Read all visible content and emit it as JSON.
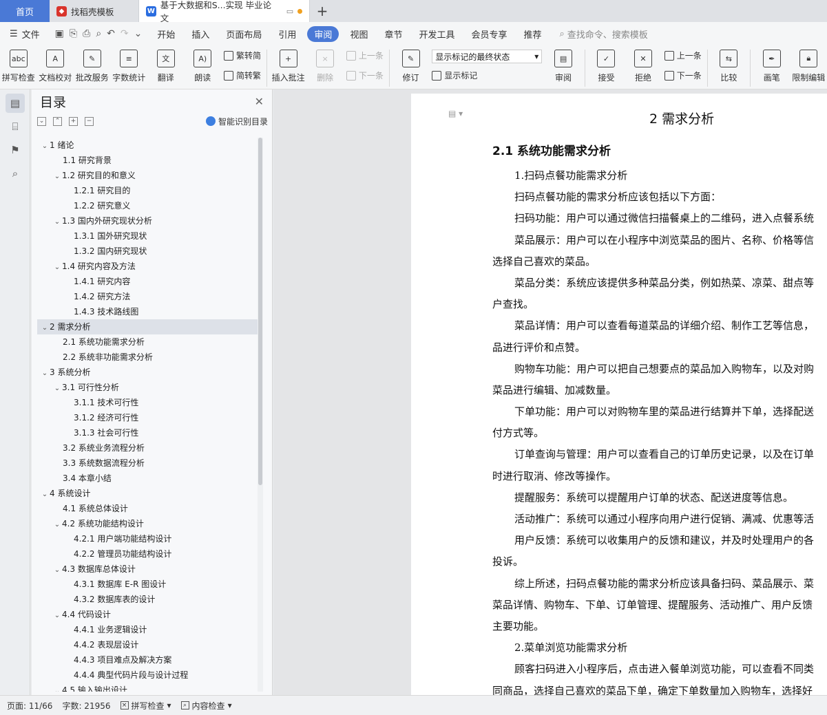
{
  "tabs": {
    "home": "首页",
    "templates": "找稻壳模板",
    "document": "基于大数据和S...实现 毕业论文"
  },
  "menu": {
    "file": "文件",
    "items": [
      "开始",
      "插入",
      "页面布局",
      "引用",
      "审阅",
      "视图",
      "章节",
      "开发工具",
      "会员专享",
      "推荐"
    ],
    "active": "审阅",
    "search_placeholder": "查找命令、搜索模板"
  },
  "ribbon": {
    "spellcheck": "拼写检查",
    "doc_proof": "文档校对",
    "review_service": "批改服务",
    "word_count": "字数统计",
    "translate": "翻译",
    "read_aloud": "朗读",
    "trad_to_simp_1": "繁转简",
    "simp_to_trad": "简转繁",
    "insert_comment": "插入批注",
    "delete": "删除",
    "prev_1": "上一条",
    "next_1": "下一条",
    "track_changes": "修订",
    "markup_select": "显示标记的最终状态",
    "show_markup": "显示标记",
    "review": "审阅",
    "accept": "接受",
    "reject": "拒绝",
    "prev_2": "上一条",
    "next_2": "下一条",
    "compare": "比较",
    "pen": "画笔",
    "restrict_edit": "限制编辑"
  },
  "toc": {
    "title": "目录",
    "smart": "智能识别目录",
    "items": [
      {
        "label": "1  绪论",
        "level": 1,
        "arrow": true
      },
      {
        "label": "1.1 研究背景",
        "level": 2,
        "arrow": false
      },
      {
        "label": "1.2 研究目的和意义",
        "level": 2,
        "arrow": true
      },
      {
        "label": "1.2.1 研究目的",
        "level": 3,
        "arrow": false
      },
      {
        "label": "1.2.2 研究意义",
        "level": 3,
        "arrow": false
      },
      {
        "label": "1.3 国内外研究现状分析",
        "level": 2,
        "arrow": true
      },
      {
        "label": "1.3.1 国外研究现状",
        "level": 3,
        "arrow": false
      },
      {
        "label": "1.3.2 国内研究现状",
        "level": 3,
        "arrow": false
      },
      {
        "label": "1.4 研究内容及方法",
        "level": 2,
        "arrow": true
      },
      {
        "label": "1.4.1 研究内容",
        "level": 3,
        "arrow": false
      },
      {
        "label": "1.4.2 研究方法",
        "level": 3,
        "arrow": false
      },
      {
        "label": "1.4.3 技术路线图",
        "level": 3,
        "arrow": false
      },
      {
        "label": "2  需求分析",
        "level": 1,
        "arrow": true,
        "selected": true
      },
      {
        "label": "2.1 系统功能需求分析",
        "level": 2,
        "arrow": false
      },
      {
        "label": "2.2 系统非功能需求分析",
        "level": 2,
        "arrow": false
      },
      {
        "label": "3  系统分析",
        "level": 1,
        "arrow": true
      },
      {
        "label": "3.1 可行性分析",
        "level": 2,
        "arrow": true
      },
      {
        "label": "3.1.1 技术可行性",
        "level": 3,
        "arrow": false
      },
      {
        "label": "3.1.2 经济可行性",
        "level": 3,
        "arrow": false
      },
      {
        "label": "3.1.3 社会可行性",
        "level": 3,
        "arrow": false
      },
      {
        "label": "3.2 系统业务流程分析",
        "level": 2,
        "arrow": false
      },
      {
        "label": "3.3 系统数据流程分析",
        "level": 2,
        "arrow": false
      },
      {
        "label": "3.4 本章小结",
        "level": 2,
        "arrow": false
      },
      {
        "label": "4  系统设计",
        "level": 1,
        "arrow": true
      },
      {
        "label": "4.1 系统总体设计",
        "level": 2,
        "arrow": false
      },
      {
        "label": "4.2 系统功能结构设计",
        "level": 2,
        "arrow": true
      },
      {
        "label": "4.2.1 用户端功能结构设计",
        "level": 3,
        "arrow": false
      },
      {
        "label": "4.2.2 管理员功能结构设计",
        "level": 3,
        "arrow": false
      },
      {
        "label": "4.3 数据库总体设计",
        "level": 2,
        "arrow": true
      },
      {
        "label": "4.3.1  数据库 E-R 图设计",
        "level": 3,
        "arrow": false
      },
      {
        "label": "4.3.2  数据库表的设计",
        "level": 3,
        "arrow": false
      },
      {
        "label": "4.4 代码设计",
        "level": 2,
        "arrow": true
      },
      {
        "label": "4.4.1 业务逻辑设计",
        "level": 3,
        "arrow": false
      },
      {
        "label": "4.4.2 表现层设计",
        "level": 3,
        "arrow": false
      },
      {
        "label": "4.4.3 项目难点及解决方案",
        "level": 3,
        "arrow": false
      },
      {
        "label": "4.4.4 典型代码片段与设计过程",
        "level": 3,
        "arrow": false
      },
      {
        "label": "4.5 输入输出设计",
        "level": 2,
        "arrow": true
      }
    ]
  },
  "document": {
    "heading1": "2  需求分析",
    "heading2": "2.1 系统功能需求分析",
    "lines": [
      {
        "text": "1.扫码点餐功能需求分析",
        "indent": true
      },
      {
        "text": "扫码点餐功能的需求分析应该包括以下方面：",
        "indent": true
      },
      {
        "text": "扫码功能：用户可以通过微信扫描餐桌上的二维码，进入点餐系统",
        "indent": true
      },
      {
        "text": "菜品展示：用户可以在小程序中浏览菜品的图片、名称、价格等信",
        "indent": true
      },
      {
        "text": "选择自己喜欢的菜品。",
        "indent": false
      },
      {
        "text": "菜品分类：系统应该提供多种菜品分类，例如热菜、凉菜、甜点等",
        "indent": true
      },
      {
        "text": "户查找。",
        "indent": false
      },
      {
        "text": "菜品详情：用户可以查看每道菜品的详细介绍、制作工艺等信息，",
        "indent": true
      },
      {
        "text": "品进行评价和点赞。",
        "indent": false
      },
      {
        "text": "购物车功能：用户可以把自己想要点的菜品加入购物车，以及对购",
        "indent": true
      },
      {
        "text": "菜品进行编辑、加减数量。",
        "indent": false
      },
      {
        "text": "下单功能：用户可以对购物车里的菜品进行结算并下单，选择配送",
        "indent": true
      },
      {
        "text": "付方式等。",
        "indent": false
      },
      {
        "text": "订单查询与管理：用户可以查看自己的订单历史记录，以及在订单",
        "indent": true
      },
      {
        "text": "时进行取消、修改等操作。",
        "indent": false
      },
      {
        "text": "提醒服务：系统可以提醒用户订单的状态、配送进度等信息。",
        "indent": true
      },
      {
        "text": "活动推广：系统可以通过小程序向用户进行促销、满减、优惠等活",
        "indent": true
      },
      {
        "text": "用户反馈：系统可以收集用户的反馈和建议，并及时处理用户的各",
        "indent": true
      },
      {
        "text": "投诉。",
        "indent": false
      },
      {
        "text": "综上所述，扫码点餐功能的需求分析应该具备扫码、菜品展示、菜",
        "indent": true
      },
      {
        "text": "菜品详情、购物车、下单、订单管理、提醒服务、活动推广、用户反馈",
        "indent": false
      },
      {
        "text": "主要功能。",
        "indent": false
      },
      {
        "text": "2.菜单浏览功能需求分析",
        "indent": true
      },
      {
        "text": "顾客扫码进入小程序后，点击进入餐单浏览功能，可以查看不同类",
        "indent": true
      },
      {
        "text": "同商品，选择自己喜欢的菜品下单，确定下单数量加入购物车，选择好",
        "indent": false
      }
    ]
  },
  "status": {
    "page": "页面: 11/66",
    "words": "字数: 21956",
    "spell": "拼写检查",
    "content": "内容检查"
  }
}
